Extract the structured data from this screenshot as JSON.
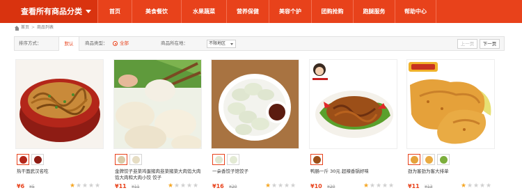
{
  "nav": {
    "category_label": "查看所有商品分类",
    "items": [
      {
        "label": "首页"
      },
      {
        "label": "美食餐饮"
      },
      {
        "label": "水果蔬菜"
      },
      {
        "label": "营养保健"
      },
      {
        "label": "美容个护"
      },
      {
        "label": "团购抢购"
      },
      {
        "label": "跑腿服务"
      },
      {
        "label": "帮助中心"
      }
    ]
  },
  "breadcrumb": {
    "home": "首页",
    "separator": ">",
    "current": "商品列表"
  },
  "filter": {
    "sort_label": "排序方式：",
    "sort_default": "默认",
    "type_label": "商品类型：",
    "type_value": "全部",
    "region_label": "商品所在地：",
    "region_value": "不限地区",
    "prev_page": "上一页",
    "next_page": "下一页"
  },
  "products": [
    {
      "name": "热干面武汉名吃",
      "price": "¥6",
      "old_price": "¥5",
      "rating": 1
    },
    {
      "name": "金牌饺子韭菜鸡蛋猪肉韭菜猪菜大肉馅大肉馅大肉和大肉小饺 饺子",
      "price": "¥11",
      "old_price": "¥11",
      "rating": 1
    },
    {
      "name": "一朵香饺子馆饺子",
      "price": "¥16",
      "old_price": "¥20",
      "rating": 1
    },
    {
      "name": "鸭肠一斤 30元 超辣香锅好味",
      "price": "¥10",
      "old_price": "¥20",
      "rating": 1
    },
    {
      "name": "劲为客劲为客大排单",
      "price": "¥11",
      "old_price": "¥13",
      "rating": 1
    }
  ],
  "colors": {
    "brand": "#e8421b",
    "star_on": "#f5a623",
    "star_off": "#cfcfcf"
  },
  "icons": [
    "home-icon",
    "chevron-down-icon",
    "radio-icon",
    "star-icon"
  ]
}
